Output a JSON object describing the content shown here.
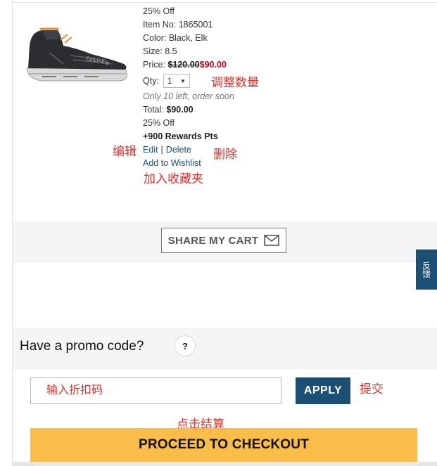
{
  "product": {
    "image_alt": "Columbia mid hiking shoe, black",
    "discount_top": "25% Off",
    "item_no": "Item No: 1865001",
    "color": "Color: Black, Elk",
    "size": "Size: 8.5",
    "price_label": "Price:",
    "price_original": "$120.00",
    "price_sale": "$90.00",
    "qty_label": "Qty:",
    "qty_value": "1",
    "stock_note": "Only 10 left, order soon",
    "total_label": "Total:",
    "total_value": "$90.00",
    "discount_bottom": "25% Off",
    "rewards": "+900 Rewards Pts",
    "edit_label": "Edit",
    "separator": "|",
    "delete_label": "Delete",
    "wishlist_label": "Add to Wishlist"
  },
  "annotations": {
    "adjust_qty": "调整数量",
    "edit": "编辑",
    "delete": "删除",
    "add_wishlist": "加入收藏夹",
    "submit": "提交",
    "checkout": "点击结算"
  },
  "share": {
    "label": "SHARE MY CART",
    "icon": "envelope-icon"
  },
  "feedback": {
    "label": "反馈"
  },
  "promo": {
    "title": "Have a promo code?",
    "help": "?",
    "placeholder": "输入折扣码",
    "apply_label": "APPLY"
  },
  "checkout": {
    "label": "PROCEED TO CHECKOUT"
  },
  "colors": {
    "navy": "#1b4f74",
    "checkout_yellow": "#fbbd4a",
    "sale_red": "#d0021b",
    "annotation_red": "#e0322e",
    "band_gray": "#f4f5f7"
  }
}
